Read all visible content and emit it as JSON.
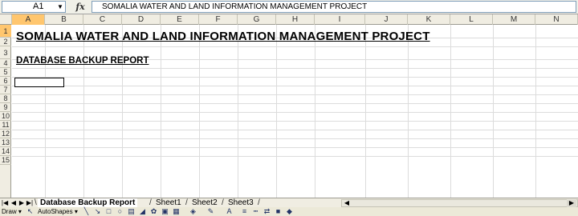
{
  "formula_bar": {
    "name_box": "A1",
    "fx_label": "fx",
    "formula_text": "SOMALIA WATER AND LAND INFORMATION MANAGEMENT PROJECT"
  },
  "columns": [
    "A",
    "B",
    "C",
    "D",
    "E",
    "F",
    "G",
    "H",
    "I",
    "J",
    "K",
    "L",
    "M",
    "N"
  ],
  "rows": [
    "1",
    "2",
    "3",
    "4",
    "5",
    "6",
    "7",
    "8",
    "9",
    "10",
    "11",
    "12",
    "13",
    "14",
    "15"
  ],
  "cells": {
    "A1": "SOMALIA WATER AND LAND INFORMATION MANAGEMENT PROJECT",
    "A3": "DATABASE BACKUP REPORT"
  },
  "sheet_tabs": {
    "active": "Database Backup Report",
    "others": [
      "Sheet1",
      "Sheet2",
      "Sheet3"
    ]
  },
  "draw_toolbar": {
    "draw_label": "Draw ▾",
    "autoshapes_label": "AutoShapes ▾"
  },
  "colors": {
    "selected_header": "#ffc66e",
    "header_bg": "#f0ede2",
    "toolbar_bg": "#ece9d8"
  }
}
